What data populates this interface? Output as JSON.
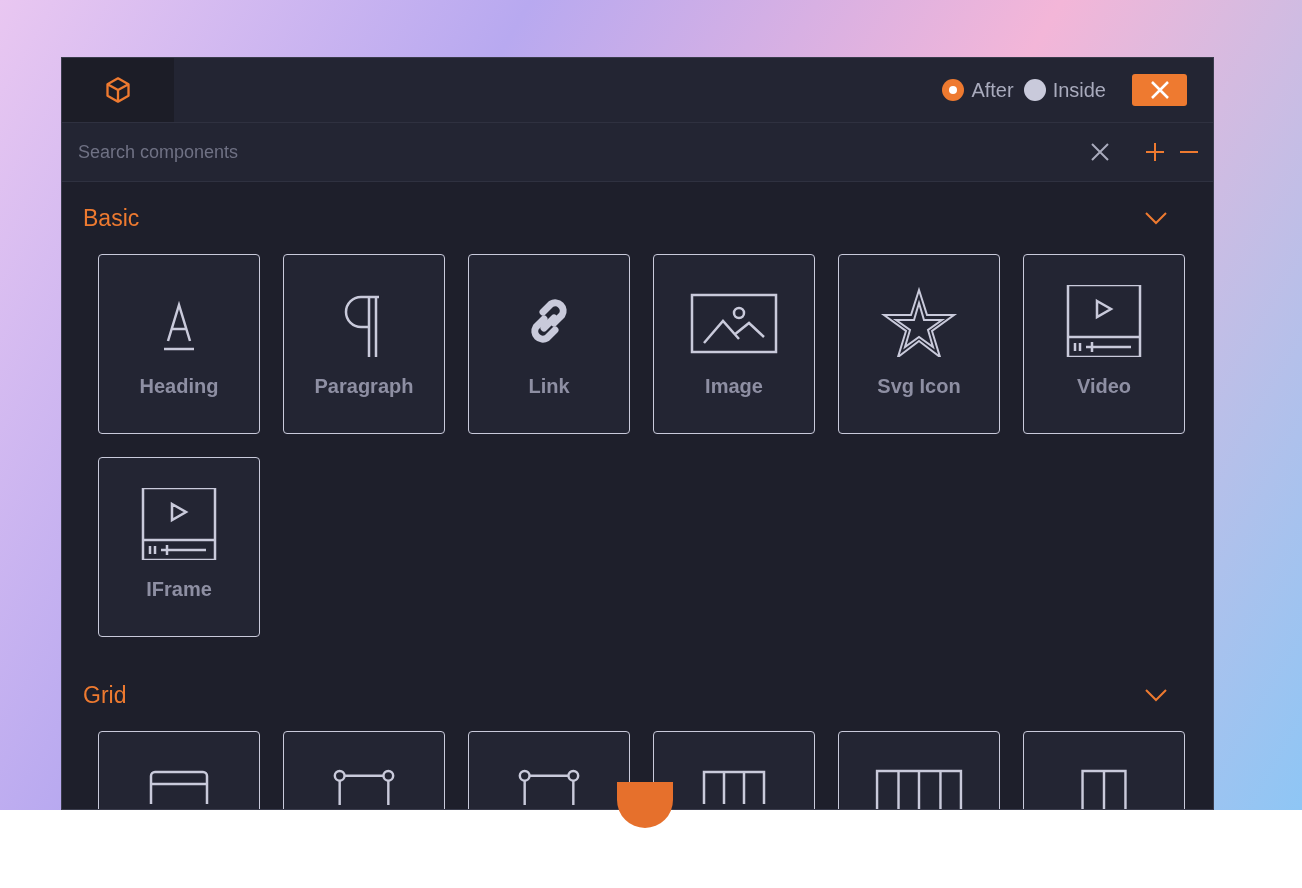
{
  "toolbar": {
    "insert_options": [
      {
        "label": "After",
        "selected": true
      },
      {
        "label": "Inside",
        "selected": false
      }
    ]
  },
  "search": {
    "placeholder": "Search components"
  },
  "sections": [
    {
      "title": "Basic",
      "expanded": true,
      "blocks": [
        {
          "kind": "heading",
          "label": "Heading"
        },
        {
          "kind": "paragraph",
          "label": "Paragraph"
        },
        {
          "kind": "link",
          "label": "Link"
        },
        {
          "kind": "image",
          "label": "Image"
        },
        {
          "kind": "star",
          "label": "Svg Icon"
        },
        {
          "kind": "video",
          "label": "Video"
        },
        {
          "kind": "video",
          "label": "IFrame"
        }
      ]
    },
    {
      "title": "Grid",
      "expanded": true,
      "blocks": [
        {
          "kind": "container"
        },
        {
          "kind": "row"
        },
        {
          "kind": "row"
        },
        {
          "kind": "columns3"
        },
        {
          "kind": "columns4"
        },
        {
          "kind": "columns2"
        }
      ]
    }
  ]
}
